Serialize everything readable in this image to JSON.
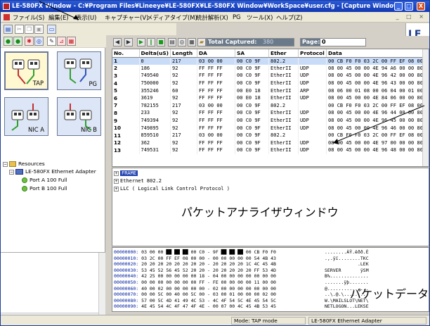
{
  "window": {
    "title": "LE-580FX Window - C:¥Program Files¥Lineeye¥LE-580FX¥LE-580FX Window¥WorkSpace¥user.cfg - [Capture Window_Port A & B]",
    "minimize": "_",
    "maximize": "□",
    "close": "X"
  },
  "menu": {
    "items": [
      "ファイル(S)",
      "編集(E)",
      "表示(U)",
      "キャプチャー(V)",
      "メディアタイプ(M)",
      "統計解析(X)",
      "PG",
      "ツール(X)",
      "ヘルプ(Z)"
    ],
    "mdi_controls": "_ □ ×"
  },
  "logo": {
    "text": "LE"
  },
  "left_panel": {
    "modes": [
      {
        "label": "TAP",
        "selected": true
      },
      {
        "label": "PG",
        "selected": false
      },
      {
        "label": "NIC A",
        "selected": false
      },
      {
        "label": "NIC B",
        "selected": false
      }
    ],
    "tree": {
      "root": "Resources",
      "adapter": "LE-580FX Ethernet Adapter",
      "ports": [
        "Port A 100 Full",
        "Port B 100 Full"
      ]
    }
  },
  "capture_bar": {
    "total_captured_label": "Total Captured:",
    "total_captured_value": "380",
    "page_label": "Page:",
    "page_value": "0"
  },
  "packet_table": {
    "columns": [
      "No.",
      "Delta(uS)",
      "Length",
      "DA",
      "SA",
      "Ether",
      "Protocol",
      "Data"
    ],
    "rows": [
      [
        "1",
        "0",
        "217",
        "03 00 00",
        "00 C0 9F",
        "802.2",
        "",
        "00 CB F0 F0 03 2C 00 FF EF 08 00"
      ],
      [
        "2",
        "186",
        "92",
        "FF FF FF",
        "00 C0 9F",
        "EtherII",
        "UDP",
        "08 00 45 00 00 4E 94 A6 00 00 80"
      ],
      [
        "3",
        "749540",
        "92",
        "FF FF FF",
        "00 C0 9F",
        "EtherII",
        "UDP",
        "08 00 45 00 00 4E 96 42 00 00 80"
      ],
      [
        "4",
        "750000",
        "92",
        "FF FF FF",
        "00 C0 9F",
        "EtherII",
        "UDP",
        "08 00 45 00 00 4E 96 43 00 00 80"
      ],
      [
        "5",
        "355246",
        "60",
        "FF FF FF",
        "00 E0 18",
        "EtherII",
        "ARP",
        "08 06 00 01 08 00 06 04 00 01 00"
      ],
      [
        "6",
        "3619",
        "92",
        "FF FF FF",
        "00 E0 18",
        "EtherII",
        "UDP",
        "08 00 45 00 00 4E 84 06 00 00 80"
      ],
      [
        "7",
        "782155",
        "217",
        "03 00 00",
        "00 C0 9F",
        "802.2",
        "",
        "00 CB F0 F0 03 2C 00 FF EF 08 00"
      ],
      [
        "8",
        "233",
        "92",
        "FF FF FF",
        "00 C0 9F",
        "EtherII",
        "UDP",
        "08 00 45 00 00 4E 96 44 00 00 80"
      ],
      [
        "9",
        "749394",
        "92",
        "FF FF FF",
        "00 C0 9F",
        "EtherII",
        "UDP",
        "08 00 45 00 00 4E 96 45 00 00 80"
      ],
      [
        "10",
        "749895",
        "92",
        "FF FF FF",
        "00 C0 9F",
        "EtherII",
        "UDP",
        "08 00 45 00 00 4E 96 46 00 00 80"
      ],
      [
        "11",
        "859510",
        "217",
        "03 00 00",
        "00 C0 9F",
        "802.2",
        "",
        "00 CB F0 F0 03 2C 00 FF EF 08 00"
      ],
      [
        "12",
        "362",
        "92",
        "FF FF FF",
        "00 C0 9F",
        "EtherII",
        "UDP",
        "08 00 45 00 00 4E 97 00 00 00 80"
      ],
      [
        "13",
        "749531",
        "92",
        "FF FF FF",
        "00 C0 9F",
        "EtherII",
        "UDP",
        "08 00 45 00 00 4E 96 48 00 00 80"
      ]
    ]
  },
  "packet_tree": {
    "frame": "FRAME",
    "ethernet": "Ethernet 802.2",
    "llc": "LLC ( Logical Link Control Protocol )"
  },
  "hex_dump": [
    {
      "offset": "00000000:",
      "hex": "03 00 00 ██ ██ ██ 00 C0 - 9F ██ ██ ██ 00 CB F0 F0",
      "ascii": "........ÀŸ.ëðð.È"
    },
    {
      "offset": "00000010:",
      "hex": "03 2C 00 FF EF 08 00 00 - 00 00 00 00 00 54 4B 43",
      "ascii": ".,.ÿï........TKC"
    },
    {
      "offset": "00000020:",
      "hex": "20 20 20 20 20 20 20 20 - 20 20 20 20 1C 4C 45 4B",
      "ascii": "            .LEK"
    },
    {
      "offset": "00000030:",
      "hex": "53 45 52 56 45 52 20 20 - 20 20 20 20 20 FF 53 4D",
      "ascii": "SERVER       ÿSM"
    },
    {
      "offset": "00000040:",
      "hex": "42 25 00 00 00 00 00 18 - 04 00 00 00 00 00 00 00",
      "ascii": "B%.............."
    },
    {
      "offset": "00000050:",
      "hex": "00 00 00 00 00 00 00 FF - FE 00 00 00 00 11 00 00",
      "ascii": ".......ÿþ......."
    },
    {
      "offset": "00000060:",
      "hex": "40 00 02 00 00 00 00 00 - 02 00 00 00 00 00 00 00",
      "ascii": "@..............."
    },
    {
      "offset": "00000070:",
      "hex": "00 00 5C 00 40 00 5C 00 - 03 00 01 00 00 00 02 00",
      "ascii": "..\\.@.\\........."
    },
    {
      "offset": "00000080:",
      "hex": "57 00 5C 4D 41 49 4C 53 - 4C 4F 54 5C 4E 45 54 5C",
      "ascii": "W.\\MAILSLOT\\NET\\"
    },
    {
      "offset": "00000090:",
      "hex": "4E 45 54 4C 4F 47 4F 4E - 00 07 00 4C 45 4B 53 45",
      "ascii": "NETLOGON...LEKSE"
    }
  ],
  "status_bar": {
    "mode": "Mode: TAP mode",
    "adapter": "LE-580FX Ethernet Adapter"
  },
  "annotations": {
    "analyzer_window": "パケットアナライザウィンドウ",
    "packet_data": "パケットデータ"
  }
}
